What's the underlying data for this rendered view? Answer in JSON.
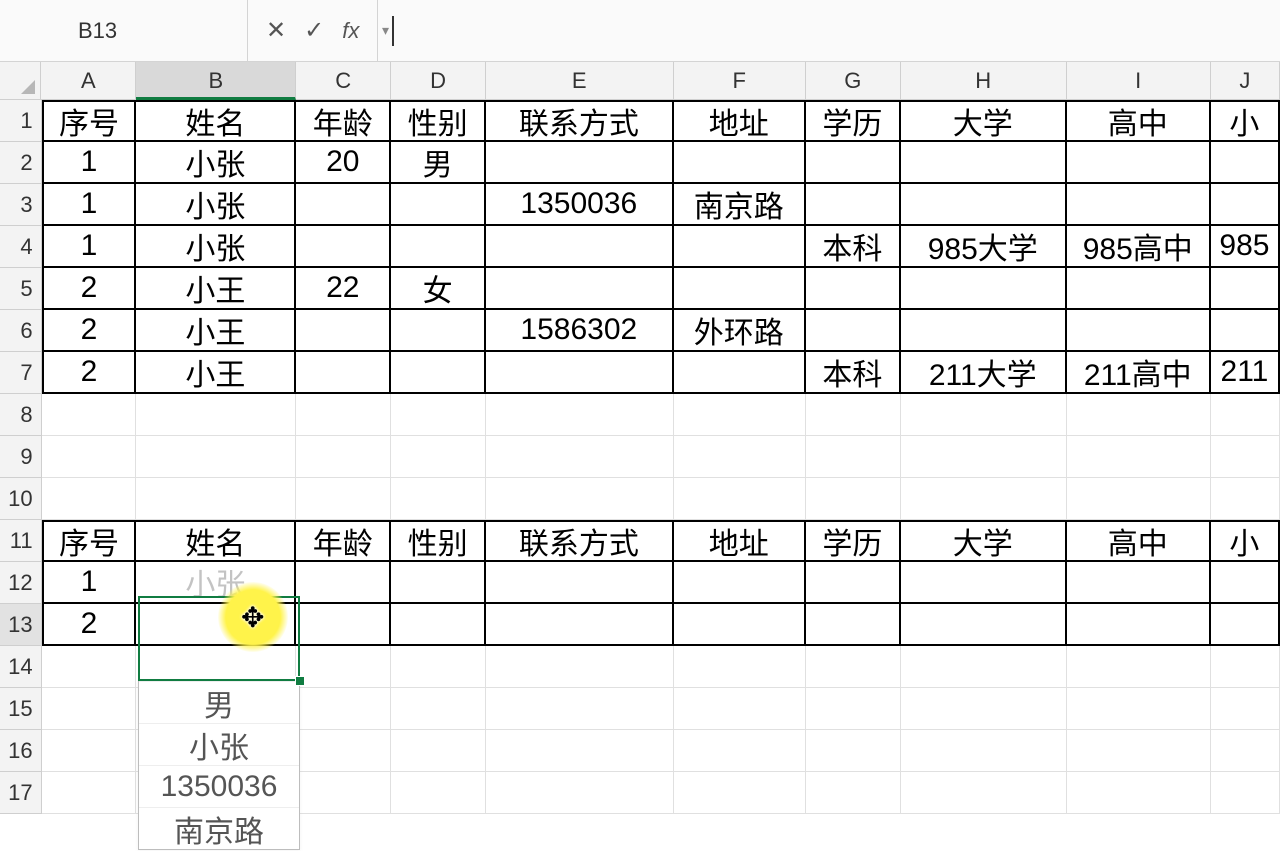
{
  "formula_bar": {
    "name_box": "B13",
    "cancel_glyph": "✕",
    "accept_glyph": "✓",
    "fx_label": "fx",
    "input_value": ""
  },
  "columns": [
    {
      "letter": "A",
      "cls": "wA"
    },
    {
      "letter": "B",
      "cls": "wB"
    },
    {
      "letter": "C",
      "cls": "wC"
    },
    {
      "letter": "D",
      "cls": "wD"
    },
    {
      "letter": "E",
      "cls": "wE"
    },
    {
      "letter": "F",
      "cls": "wF"
    },
    {
      "letter": "G",
      "cls": "wG"
    },
    {
      "letter": "H",
      "cls": "wH"
    },
    {
      "letter": "I",
      "cls": "wI"
    },
    {
      "letter": "J",
      "cls": "wJ"
    }
  ],
  "row_numbers": [
    1,
    2,
    3,
    4,
    5,
    6,
    7,
    8,
    9,
    10,
    11,
    12,
    13,
    14,
    15,
    16,
    17
  ],
  "active_row": 13,
  "active_col": "B",
  "table1": {
    "headers": [
      "序号",
      "姓名",
      "年龄",
      "性别",
      "联系方式",
      "地址",
      "学历",
      "大学",
      "高中",
      "小"
    ],
    "rows": [
      [
        "1",
        "小张",
        "20",
        "男",
        "",
        "",
        "",
        "",
        "",
        ""
      ],
      [
        "1",
        "小张",
        "",
        "",
        "1350036",
        "南京路",
        "",
        "",
        "",
        ""
      ],
      [
        "1",
        "小张",
        "",
        "",
        "",
        "",
        "本科",
        "985大学",
        "985高中",
        "985"
      ],
      [
        "2",
        "小王",
        "22",
        "女",
        "",
        "",
        "",
        "",
        "",
        ""
      ],
      [
        "2",
        "小王",
        "",
        "",
        "1586302",
        "外环路",
        "",
        "",
        "",
        ""
      ],
      [
        "2",
        "小王",
        "",
        "",
        "",
        "",
        "本科",
        "211大学",
        "211高中",
        "211"
      ]
    ]
  },
  "table2": {
    "headers": [
      "序号",
      "姓名",
      "年龄",
      "性别",
      "联系方式",
      "地址",
      "学历",
      "大学",
      "高中",
      "小"
    ],
    "rows": [
      [
        "1",
        "小张",
        "",
        "",
        "",
        "",
        "",
        "",
        "",
        ""
      ],
      [
        "2",
        "",
        "",
        "",
        "",
        "",
        "",
        "",
        "",
        ""
      ]
    ]
  },
  "dropdown_items": [
    "男",
    "小张",
    "1350036",
    "南京路"
  ],
  "cell_b12_faint": "小张"
}
